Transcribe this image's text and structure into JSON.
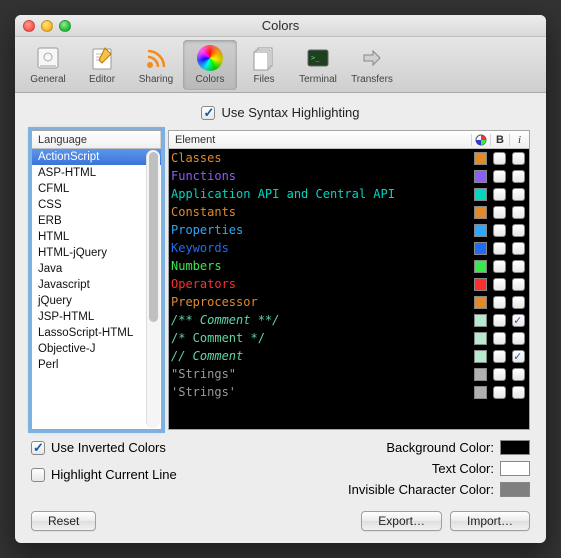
{
  "window": {
    "title": "Colors"
  },
  "toolbar": {
    "items": [
      {
        "label": "General"
      },
      {
        "label": "Editor"
      },
      {
        "label": "Sharing"
      },
      {
        "label": "Colors",
        "selected": true
      },
      {
        "label": "Files"
      },
      {
        "label": "Terminal"
      },
      {
        "label": "Transfers"
      }
    ]
  },
  "topCheckbox": {
    "label": "Use Syntax Highlighting",
    "checked": true
  },
  "languageHeader": "Language",
  "languages": [
    {
      "name": "ActionScript",
      "selected": true
    },
    {
      "name": "ASP-HTML"
    },
    {
      "name": "CFML"
    },
    {
      "name": "CSS"
    },
    {
      "name": "ERB"
    },
    {
      "name": "HTML"
    },
    {
      "name": "HTML-jQuery"
    },
    {
      "name": "Java"
    },
    {
      "name": "Javascript"
    },
    {
      "name": "jQuery"
    },
    {
      "name": "JSP-HTML"
    },
    {
      "name": "LassoScript-HTML"
    },
    {
      "name": "Objective-J"
    },
    {
      "name": "Perl"
    }
  ],
  "elementHeader": {
    "label": "Element",
    "colorAbbr": "◯",
    "boldAbbr": "B",
    "italicAbbr": "i"
  },
  "elements": [
    {
      "label": "Classes",
      "color": "#e08a2c",
      "swatch": "#e08a2c",
      "bold": false,
      "italic": false
    },
    {
      "label": "Functions",
      "color": "#8a5ff5",
      "swatch": "#8a5ff5",
      "bold": false,
      "italic": false
    },
    {
      "label": "Application API and Central API",
      "color": "#00d6c0",
      "swatch": "#00d6c0",
      "bold": false,
      "italic": false
    },
    {
      "label": "Constants",
      "color": "#e08a2c",
      "swatch": "#e08a2c",
      "bold": false,
      "italic": false
    },
    {
      "label": "Properties",
      "color": "#2ca9ff",
      "swatch": "#2ca9ff",
      "bold": false,
      "italic": false
    },
    {
      "label": "Keywords",
      "color": "#1e6df2",
      "swatch": "#1e6df2",
      "bold": false,
      "italic": false
    },
    {
      "label": "Numbers",
      "color": "#38e84c",
      "swatch": "#38e84c",
      "bold": false,
      "italic": false
    },
    {
      "label": "Operators",
      "color": "#ff2e2e",
      "swatch": "#ff2e2e",
      "bold": false,
      "italic": false
    },
    {
      "label": "Preprocessor",
      "color": "#e08a2c",
      "swatch": "#e08a2c",
      "bold": false,
      "italic": false
    },
    {
      "label": "/** Comment **/",
      "color": "#5fd6a5",
      "swatch": "#b6e9cf",
      "bold": false,
      "italic": true
    },
    {
      "label": "/* Comment */",
      "color": "#5fd6a5",
      "swatch": "#b6e9cf",
      "bold": false,
      "italic": false
    },
    {
      "label": "// Comment",
      "color": "#5fd6a5",
      "swatch": "#b6e9cf",
      "bold": false,
      "italic": true
    },
    {
      "label": "\"Strings\"",
      "color": "#9a9a9a",
      "swatch": "#b0b0b0",
      "bold": false,
      "italic": false
    },
    {
      "label": "'Strings'",
      "color": "#9a9a9a",
      "swatch": "#b0b0b0",
      "bold": false,
      "italic": false
    }
  ],
  "options": {
    "invertedColors": {
      "label": "Use Inverted Colors",
      "checked": true
    },
    "highlightLine": {
      "label": "Highlight Current Line",
      "checked": false
    },
    "backgroundColor": {
      "label": "Background Color:",
      "color": "#000000"
    },
    "textColor": {
      "label": "Text Color:",
      "color": "#ffffff"
    },
    "invisibleColor": {
      "label": "Invisible Character Color:",
      "color": "#808080"
    }
  },
  "buttons": {
    "reset": "Reset",
    "export": "Export…",
    "import": "Import…"
  }
}
